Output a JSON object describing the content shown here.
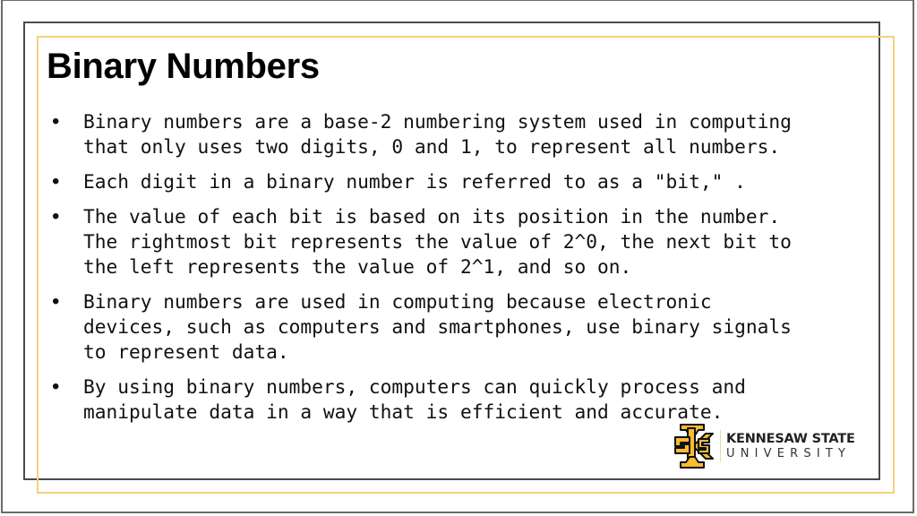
{
  "slide": {
    "title": "Binary Numbers",
    "bullets": [
      {
        "text": "Binary numbers are a base-2 numbering system used in computing\nthat only uses two digits, 0 and 1, to represent all numbers."
      },
      {
        "text": "Each digit in a binary number is referred to as a \"bit,\" ."
      },
      {
        "text": "The value of each bit is based on its position in the number.\nThe rightmost bit represents the value of 2^0, the next bit to\nthe left represents the value of 2^1, and so on."
      },
      {
        "text": "Binary numbers are used in computing because electronic\ndevices, such as computers and smartphones, use binary signals\nto represent data."
      },
      {
        "text": "By using binary numbers, computers can quickly process and\nmanipulate data in a way that is efficient and accurate."
      }
    ],
    "bullet_glyph": "•"
  },
  "logo": {
    "name_line1": "KENNESAW STATE",
    "name_line2": "UNIVERSITY",
    "icon": "ksu-monogram-icon",
    "colors": {
      "gold": "#FDBB30",
      "black": "#0B1315"
    }
  },
  "colors": {
    "frame_dark": "#4a4a4a",
    "frame_gold": "#f2d27a",
    "outer_border": "#6b6b6b"
  }
}
